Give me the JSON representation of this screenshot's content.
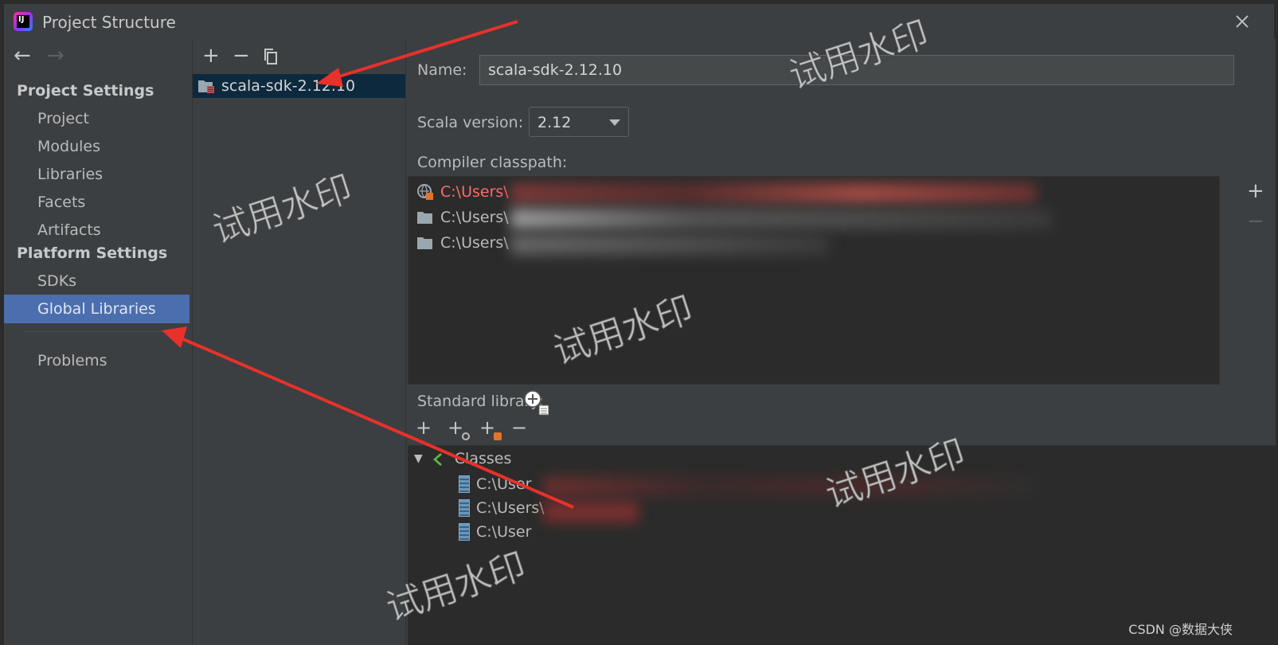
{
  "window": {
    "title": "Project Structure"
  },
  "nav": {
    "project_settings_header": "Project Settings",
    "project_items": [
      {
        "label": "Project"
      },
      {
        "label": "Modules"
      },
      {
        "label": "Libraries"
      },
      {
        "label": "Facets"
      },
      {
        "label": "Artifacts"
      }
    ],
    "platform_settings_header": "Platform Settings",
    "platform_items": [
      {
        "label": "SDKs"
      },
      {
        "label": "Global Libraries",
        "selected": true
      }
    ],
    "problems_label": "Problems"
  },
  "libraries": {
    "toolbar": {
      "add": "+",
      "remove": "−"
    },
    "items": [
      {
        "label": "scala-sdk-2.12.10",
        "selected": true
      }
    ]
  },
  "detail": {
    "name_label": "Name:",
    "name_value": "scala-sdk-2.12.10",
    "scala_version_label": "Scala version:",
    "scala_version_value": "2.12",
    "compiler_classpath_label": "Compiler classpath:",
    "classpath": [
      {
        "path": "C:\\Users\\",
        "error": true
      },
      {
        "path": "C:\\Users\\",
        "error": false
      },
      {
        "path": "C:\\Users\\",
        "error": false
      }
    ],
    "standard_library_label": "Standard library:",
    "tree": {
      "classes_label": "Classes",
      "children": [
        {
          "path": "C:\\User"
        },
        {
          "path": "C:\\Users\\"
        },
        {
          "path": "C:\\User"
        }
      ]
    }
  },
  "watermark_text": "试用水印",
  "credit": "CSDN @数据大侠",
  "colors": {
    "selection": "#4b6eaf",
    "list_selection": "#0d293e",
    "error_text": "#ff6b68",
    "annotation_arrow": "#e8312a"
  }
}
